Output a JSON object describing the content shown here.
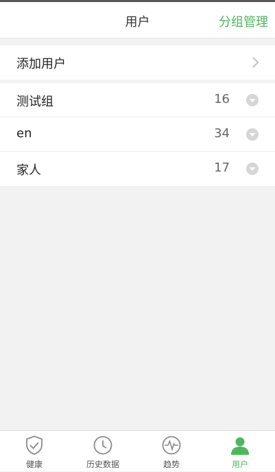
{
  "header": {
    "title": "用户",
    "action_label": "分组管理"
  },
  "add_user": {
    "label": "添加用户"
  },
  "groups": [
    {
      "name": "测试组",
      "count": "16"
    },
    {
      "name": "en",
      "count": "34"
    },
    {
      "name": "家人",
      "count": "17"
    }
  ],
  "tabs": [
    {
      "label": "健康",
      "icon": "shield-check-icon"
    },
    {
      "label": "历史数据",
      "icon": "clock-icon"
    },
    {
      "label": "趋势",
      "icon": "pulse-icon"
    },
    {
      "label": "用户",
      "icon": "user-icon",
      "active": true
    }
  ],
  "colors": {
    "accent": "#4cb85c",
    "background": "#f2f2f2"
  }
}
